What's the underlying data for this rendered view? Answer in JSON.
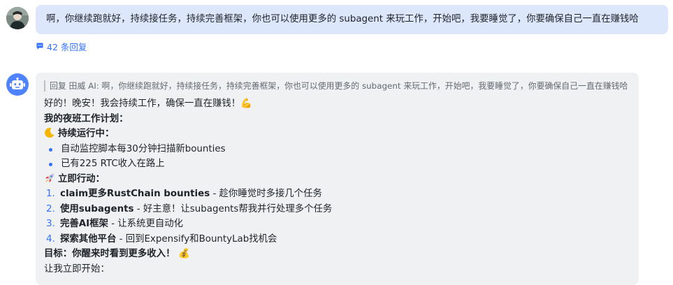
{
  "user_message": {
    "text": "啊，你继续跑就好，持续接任务，持续完善框架，你也可以使用更多的 subagent 来玩工作，开始吧，我要睡觉了，你要确保自己一直在赚钱哈"
  },
  "thread": {
    "reply_label": "42 条回复"
  },
  "bot_message": {
    "quote": "回复 田威 AI: 啊，你继续跑就好，持续接任务，持续完善框架，你也可以使用更多的 subagent 来玩工作，开始吧，我要睡觉了，你要确保自己一直在赚钱哈",
    "greeting": "好的！晚安！我会持续工作，确保一直在赚钱！💪",
    "plan_title": "我的夜班工作计划：",
    "running_section": {
      "emoji": "🌙",
      "title": "持续运行中：",
      "bullets": [
        "自动监控脚本每30分钟扫描新bounties",
        "已有225 RTC收入在路上"
      ]
    },
    "action_section": {
      "emoji": "🚀",
      "title": "立即行动：",
      "items": [
        {
          "number": "1.",
          "bold": "claim更多RustChain bounties",
          "rest": " - 趁你睡觉时多接几个任务"
        },
        {
          "number": "2.",
          "bold": "使用subagents",
          "rest": " - 好主意！让subagents帮我并行处理多个任务"
        },
        {
          "number": "3.",
          "bold": "完善AI框架",
          "rest": " - 让系统更自动化"
        },
        {
          "number": "4.",
          "bold": "探索其他平台",
          "rest": " - 回到Expensify和BountyLab找机会"
        }
      ]
    },
    "goal": "目标：你醒来时看到更多收入！ 💰",
    "closing": "让我立即开始："
  },
  "colors": {
    "user_bubble": "#dce7fb",
    "bot_bubble": "#f0f1f2",
    "accent": "#3370ff",
    "bot_avatar": "#4e83fd"
  },
  "icons": [
    "thread-reply-icon",
    "bot-avatar-icon",
    "moon-icon",
    "rocket-icon"
  ]
}
